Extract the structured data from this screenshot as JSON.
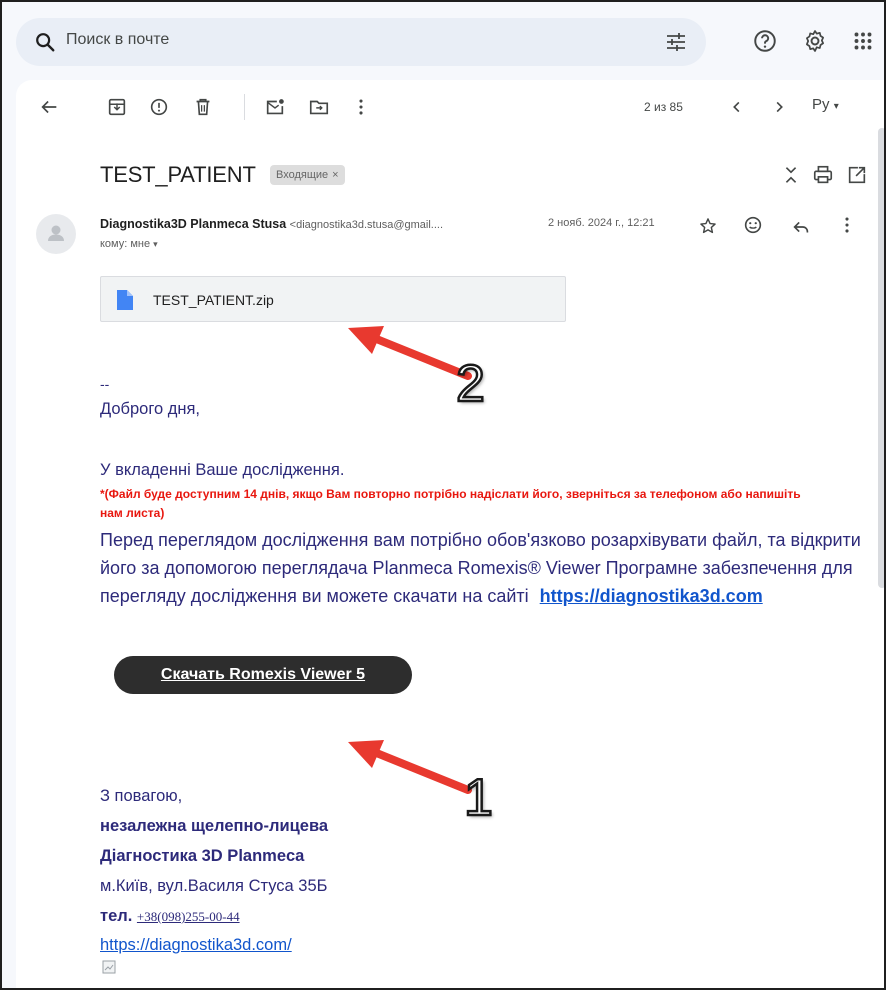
{
  "search": {
    "placeholder": "Поиск в почте"
  },
  "toolbar": {
    "pager": "2 из 85",
    "language": "Ру"
  },
  "email": {
    "subject": "TEST_PATIENT",
    "label": "Входящие",
    "label_close": "×",
    "sender_name": "Diagnostika3D Planmeca Stusa",
    "sender_email": "<diagnostika3d.stusa@gmail....",
    "date": "2 нояб. 2024 г., 12:21",
    "to": "кому: мне",
    "attachment": "TEST_PATIENT.zip",
    "dash": "--",
    "greeting": "Доброго дня,",
    "intro": "У вкладенні Ваше дослідження.",
    "note": "*(Файл буде доступним 14 днів, якщо Вам повторно потрібно надіслати його, зверніться за телефоном або напишіть нам листа)",
    "instructions_1": "Перед переглядом дослідження вам потрібно обов'язково розархівувати файл, та відкрити його за допомогою переглядача  Planmeca Romexis® Viewer",
    "instructions_2": "Програмне забезпечення для перегляду дослідження ви можете скачати на сайті",
    "site_link": "https://diagnostika3d.com",
    "download_button": "Скачать Romexis Viewer 5",
    "regards": "З повагою,",
    "sig_line1": "незалежна щелепно-лицева",
    "sig_line2": "Діагностика 3D Planmeca",
    "address": "м.Київ, вул.Василя Стуса 35Б",
    "phone_label": "тел.",
    "phone": "+38(098)255-00-44",
    "sig_link": "https://diagnostika3d.com/"
  },
  "annotations": {
    "arrow_1": "1",
    "arrow_2": "2",
    "color": "#e8392f"
  },
  "colors": {
    "body_text": "#2d2a7a",
    "note_red": "#e8170f",
    "link": "#1155cc",
    "button_bg": "#2d2d2d"
  }
}
